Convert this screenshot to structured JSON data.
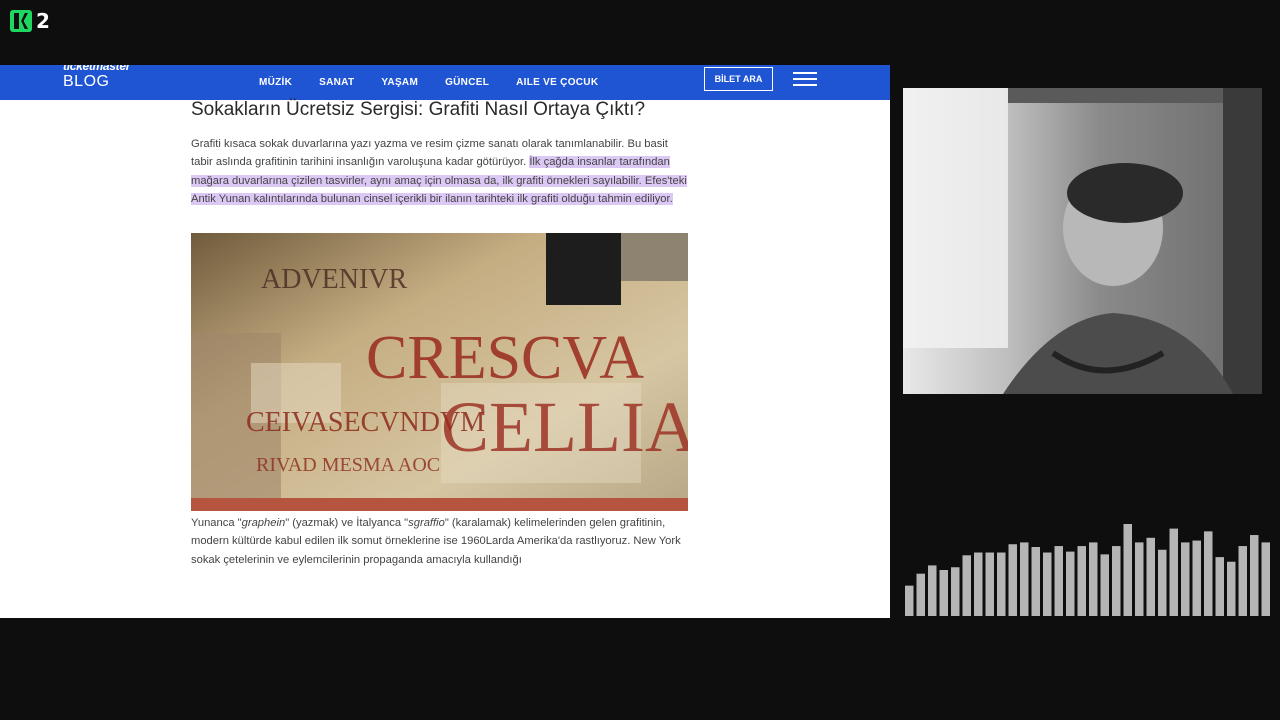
{
  "logo": {
    "number": "2"
  },
  "nav": {
    "brand_top": "ticketmaster",
    "brand_blog": "BLOG",
    "links": [
      "MÜZİK",
      "SANAT",
      "YAŞAM",
      "GÜNCEL",
      "AILE VE ÇOCUK"
    ],
    "ticket_button": "BİLET ARA"
  },
  "article": {
    "title": "Sokakların Ücretsiz Sergisi: Grafiti Nasıl Ortaya Çıktı?",
    "para1_plain": "Grafiti kısaca sokak duvarlarına yazı yazma ve resim çizme sanatı olarak tanımlanabilir. Bu basit tabir aslında grafitinin tarihini insanlığın varoluşuna kadar götürüyor. ",
    "para1_highlight": "İlk çağda insanlar tarafından mağara duvarlarına çizilen tasvirler, aynı amaç için olmasa da, ilk grafiti örnekleri sayılabilir. Efes'teki Antik Yunan kalıntılarında bulunan cinsel içerikli bir ilanın tarihteki ilk grafiti olduğu tahmin ediliyor.",
    "image_letters": [
      "CRESCVA",
      "CEIVASECVNDVM",
      "CELLIA",
      "RIVAD MESMA AOC",
      "ADVENIVR"
    ],
    "para2_a": "Yunanca \"",
    "para2_b": "graphein",
    "para2_c": "\" (yazmak) ve İtalyanca \"",
    "para2_d": "sgraffio",
    "para2_e": "\" (karalamak) kelimelerinden gelen grafitinin, modern kültürde kabul edilen ilk somut örneklerine ise 1960Larda Amerika'da rastlıyoruz. New York sokak çetelerinin ve eylemcilerinin propaganda amacıyla kullandığı"
  },
  "visualizer": {
    "levels": [
      0.33,
      0.46,
      0.55,
      0.5,
      0.53,
      0.66,
      0.69,
      0.69,
      0.69,
      0.78,
      0.8,
      0.75,
      0.69,
      0.76,
      0.7,
      0.76,
      0.8,
      0.67,
      0.76,
      1.0,
      0.8,
      0.85,
      0.72,
      0.95,
      0.8,
      0.82,
      0.92,
      0.64,
      0.59,
      0.76,
      0.88,
      0.8
    ]
  }
}
